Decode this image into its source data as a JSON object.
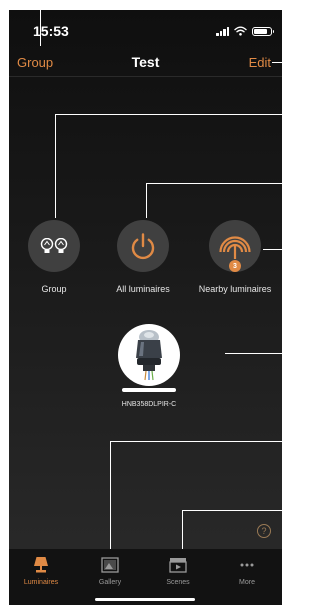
{
  "status_bar": {
    "time": "15:53"
  },
  "nav": {
    "left": "Group",
    "title": "Test",
    "right": "Edit"
  },
  "tiles": [
    {
      "label": "Group",
      "icon": "group-luminaires-icon"
    },
    {
      "label": "All luminaires",
      "icon": "power-icon"
    },
    {
      "label": "Nearby luminaires",
      "icon": "nearby-signal-icon",
      "badge": "3"
    }
  ],
  "device": {
    "label": "HNB358DLPIR-C",
    "icon": "luminaire-product-image"
  },
  "help": {
    "symbol": "?"
  },
  "tabs": [
    {
      "label": "Luminaires",
      "icon": "lamp-icon",
      "active": true
    },
    {
      "label": "Gallery",
      "icon": "gallery-icon",
      "active": false
    },
    {
      "label": "Scenes",
      "icon": "clapperboard-icon",
      "active": false
    },
    {
      "label": "More",
      "icon": "more-dots-icon",
      "active": false
    }
  ],
  "colors": {
    "accent": "#e08a45",
    "background": "#1b1b1b",
    "tile": "#404040"
  }
}
